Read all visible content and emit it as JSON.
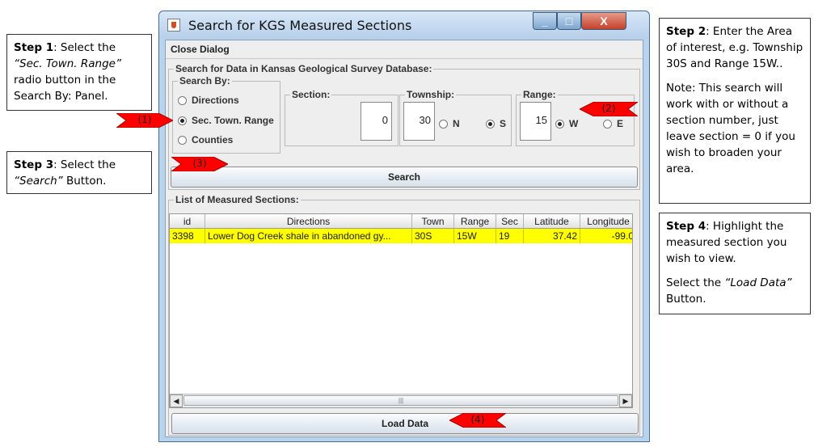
{
  "window": {
    "title": "Search for KGS Measured Sections",
    "menu_close": "Close Dialog",
    "btn_min": "_",
    "btn_max": "□",
    "btn_close": "X"
  },
  "search_panel": {
    "label": "Search for Data in Kansas Geological Survey Database:",
    "search_by": {
      "label": "Search By:",
      "options": [
        {
          "label": "Directions",
          "selected": false
        },
        {
          "label": "Sec. Town. Range",
          "selected": true
        },
        {
          "label": "Counties",
          "selected": false
        }
      ]
    },
    "section": {
      "label": "Section:",
      "value": "0"
    },
    "township": {
      "label": "Township:",
      "value": "30",
      "dir_n": "N",
      "dir_s": "S",
      "selected": "S"
    },
    "range": {
      "label": "Range:",
      "value": "15",
      "dir_w": "W",
      "dir_e": "E",
      "selected": "W"
    },
    "search_button": "Search"
  },
  "list_panel": {
    "label": "List of Measured Sections:",
    "columns": [
      "id",
      "Directions",
      "Town",
      "Range",
      "Sec",
      "Latitude",
      "Longitude"
    ],
    "rows": [
      {
        "id": "3398",
        "directions": "Lower Dog Creek shale in abandoned gy...",
        "town": "30S",
        "range": "15W",
        "sec": "19",
        "latitude": "37.42",
        "longitude": "-99.0"
      }
    ],
    "scroll_left": "◀",
    "scroll_right": "▶",
    "scroll_thumb": "|||",
    "load_button": "Load Data"
  },
  "callouts": {
    "step1": {
      "head": "Step 1",
      "pre": ": Select the ",
      "em": "“Sec. Town. Range”",
      "post": " radio button in the Search By: Panel."
    },
    "step2": {
      "head": "Step 2",
      "text": ": Enter the Area of interest, e.g. Township 30S and Range 15W..",
      "note": "Note: This search will work with or without a section number, just leave section = 0 if you wish to broaden your area."
    },
    "step3": {
      "head": "Step 3",
      "pre": ": Select the ",
      "em": "“Search”",
      "post": " Button."
    },
    "step4": {
      "head": "Step 4",
      "text": ": Highlight the measured section you wish to view.",
      "pre2": "Select the ",
      "em2": "“Load Data”",
      "post2": " Button."
    }
  },
  "arrows": [
    "(1)",
    "(2)",
    "(3)",
    "(4)"
  ],
  "colors": {
    "highlight_row": "#ffff00",
    "arrow_fill": "#ff0000"
  }
}
